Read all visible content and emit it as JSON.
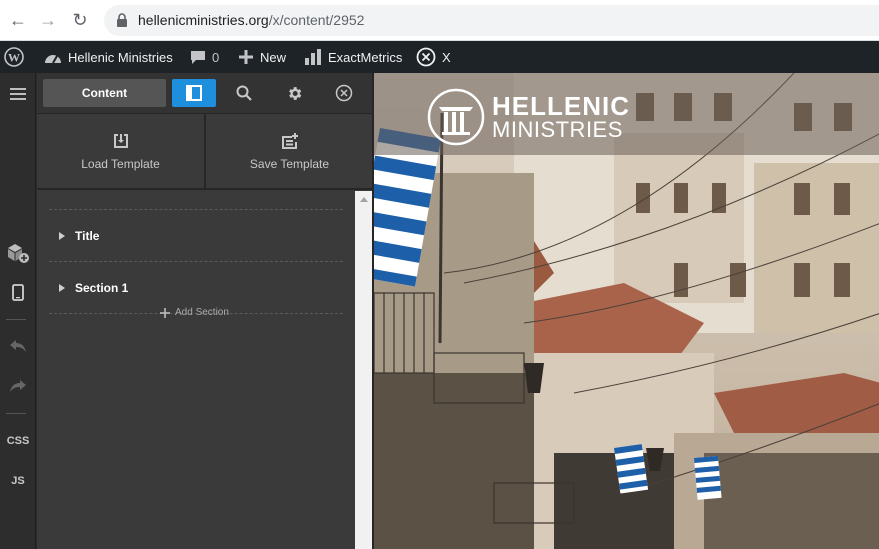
{
  "browser": {
    "url_domain": "hellenicministries.org",
    "url_path": "/x/content/2952"
  },
  "adminbar": {
    "site_name": "Hellenic Ministries",
    "comments_count": "0",
    "new_label": "New",
    "exactmetrics_label": "ExactMetrics",
    "x_label": "X"
  },
  "leftstrip": {
    "css_label": "CSS",
    "js_label": "JS"
  },
  "panel": {
    "content_tab": "Content",
    "load_template": "Load Template",
    "save_template": "Save Template",
    "outline": [
      {
        "label": "Title"
      },
      {
        "label": "Section 1"
      }
    ],
    "add_section": "Add Section"
  },
  "preview": {
    "logo_line1": "HELLENIC",
    "logo_line2": "MINISTRIES"
  },
  "colors": {
    "accent": "#1e8fdd",
    "adminbar": "#1d2327",
    "panel": "#3a3a3a"
  }
}
